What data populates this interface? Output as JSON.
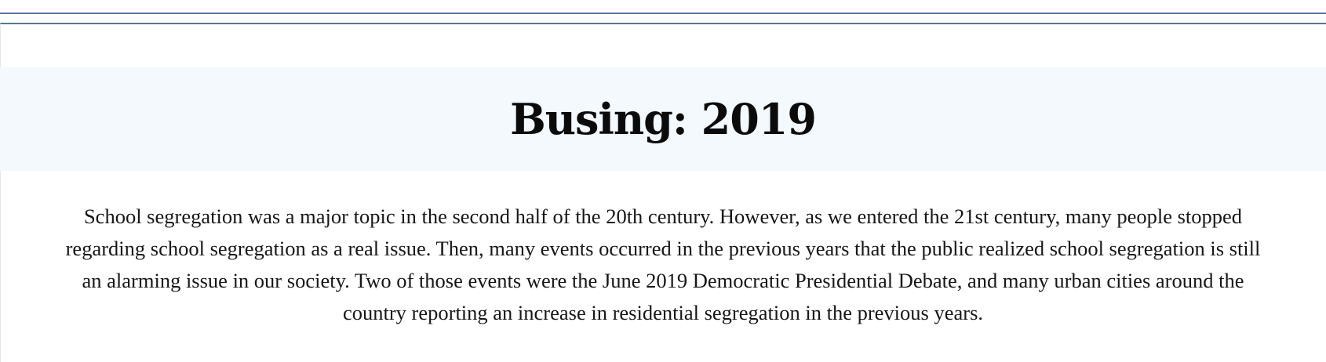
{
  "header": {
    "title": "Busing: 2019"
  },
  "main": {
    "paragraph": "School segregation was a major topic in the second half of the 20th century. However, as we entered the 21st century, many people stopped regarding school segregation as a real issue. Then, many events occurred in the previous years that the public realized school segregation is still an alarming issue in our society. Two of those events were the June 2019 Democratic Presidential Debate, and many urban cities around the country reporting an increase in residential segregation in the previous years."
  },
  "colors": {
    "rule": "#3f7fa8",
    "title_band": "#f3f9fd",
    "text": "#111111"
  }
}
